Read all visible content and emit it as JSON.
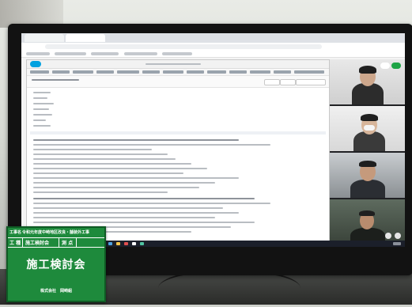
{
  "scene": {
    "colors": {
      "board_green": "#1e8a3c",
      "screen_bg": "#f4f4f4",
      "monitor": "#121212"
    }
  },
  "board": {
    "header_label": "工事名",
    "project_name": "令和元年度中崎地区改良・舗装外工事",
    "subject_label": "工 種",
    "subject_value": "施工検討会",
    "location_label": "測 点",
    "location_value": "",
    "main_title": "施工検討会",
    "company": "株式会社　岡崎組"
  },
  "screen": {
    "window_title": "パソコン画面"
  }
}
